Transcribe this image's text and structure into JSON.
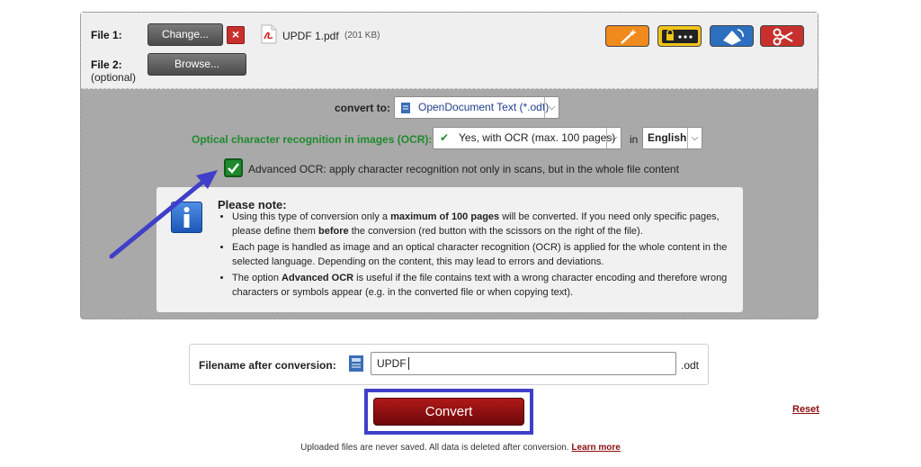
{
  "file1": {
    "label": "File 1:",
    "change_label": "Change...",
    "remove_icon": "x-icon",
    "file_icon": "pdf-icon",
    "filename": "UPDF 1.pdf",
    "filesize": "(201 KB)"
  },
  "file2": {
    "label": "File 2:",
    "optional": "(optional)",
    "browse_label": "Browse..."
  },
  "tools": [
    {
      "icon": "magic-wand-icon",
      "color": "#f08a1d"
    },
    {
      "icon": "lock-password-icon",
      "color": "#f0c419"
    },
    {
      "icon": "rotate-icon",
      "color": "#2d6fbf"
    },
    {
      "icon": "scissors-icon",
      "color": "#c8302e"
    }
  ],
  "convert_to": {
    "label": "convert to:",
    "value": "OpenDocument Text (*.odt)"
  },
  "ocr": {
    "label": "Optical character recognition in images (OCR):",
    "value": "Yes, with OCR (max. 100 pages)",
    "in_label": "in",
    "language": "English",
    "label_color": "#1f8a2d"
  },
  "advanced_ocr": {
    "checked": true,
    "label": "Advanced OCR: apply character recognition not only in scans, but in the whole file content"
  },
  "note": {
    "title": "Please note:",
    "bullets": [
      {
        "a": "Using this type of conversion only a ",
        "b": "maximum of 100 pages",
        "c": " will be converted. If you need only specific pages, please define them ",
        "d": "before",
        "e": " the conversion (red button with the scissors on the right of the file)."
      },
      {
        "a": "Each page is handled as image and an optical character recognition (OCR) is applied for the whole content in the selected language. Depending on the content, this may lead to errors and deviations."
      },
      {
        "a": "The option ",
        "b": "Advanced OCR",
        "c": " is useful if the file contains text with a wrong character encoding and therefore wrong characters or symbols appear (e.g. in the converted file or when copying text)."
      }
    ]
  },
  "filename_after": {
    "label": "Filename after conversion:",
    "value": "UPDF",
    "ext": ".odt"
  },
  "convert_label": "Convert",
  "reset_label": "Reset",
  "footer": {
    "text": "Uploaded files are never saved. All data is deleted after conversion.",
    "link": "Learn more"
  }
}
